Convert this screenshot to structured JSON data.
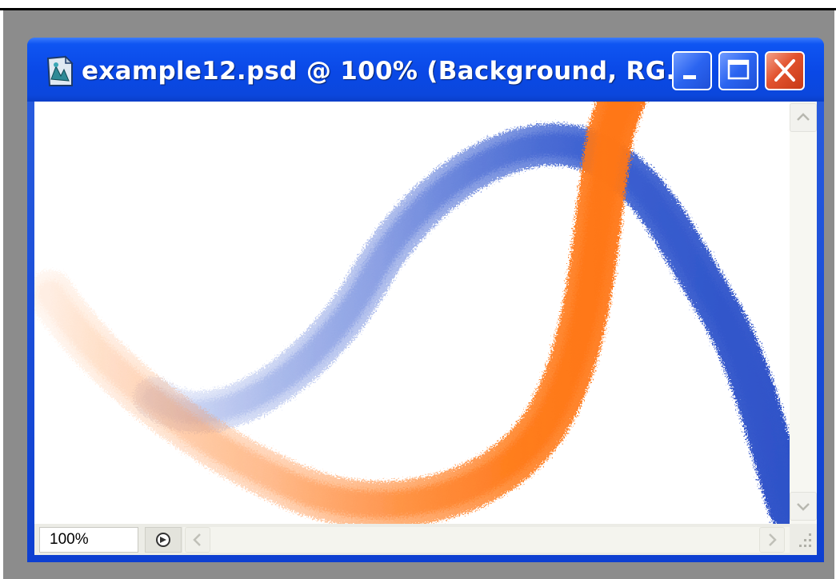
{
  "window": {
    "title": "example12.psd @ 100% (Background, RG..."
  },
  "statusbar": {
    "zoom": "100%"
  },
  "icons": {
    "document": "psd-document-icon",
    "minimize": "minimize-icon",
    "maximize": "maximize-icon",
    "close": "close-icon",
    "scroll_up": "scroll-up-arrow-icon",
    "scroll_down": "scroll-down-arrow-icon",
    "scroll_left": "scroll-left-arrow-icon",
    "scroll_right": "scroll-right-arrow-icon",
    "status_menu": "status-menu-icon",
    "resize_grip": "resize-grip-icon"
  },
  "colors": {
    "title_bar": "#0a48e6",
    "close_button": "#e2532e",
    "stroke_orange": "#ff7a1a",
    "stroke_blue": "#3a5fd0",
    "desktop": "#8c8c8c"
  }
}
